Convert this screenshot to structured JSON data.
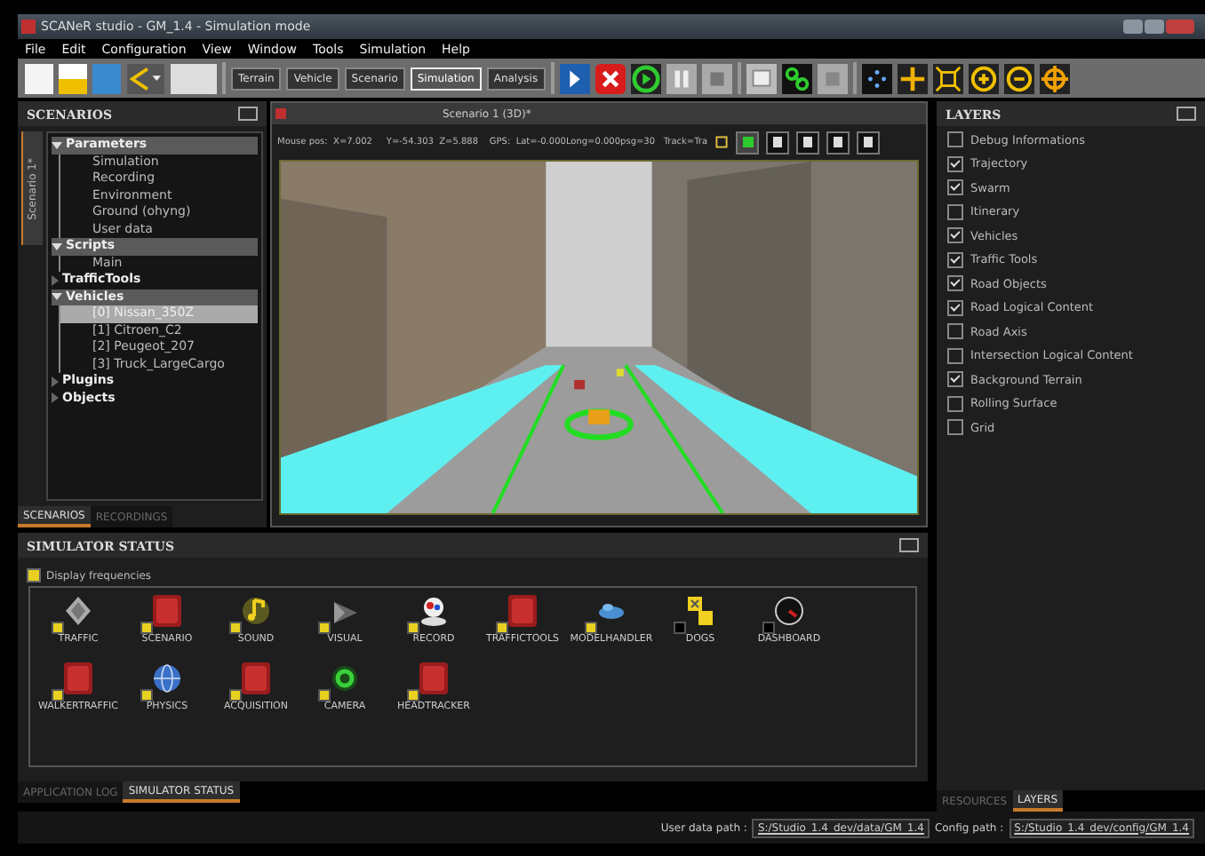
{
  "window": {
    "title": "SCANeR studio - GM_1.4 - Simulation mode"
  },
  "menu": [
    "File",
    "Edit",
    "Configuration",
    "View",
    "Window",
    "Tools",
    "Simulation",
    "Help"
  ],
  "modes": [
    {
      "label": "Terrain",
      "selected": false
    },
    {
      "label": "Vehicle",
      "selected": false
    },
    {
      "label": "Scenario",
      "selected": false
    },
    {
      "label": "Simulation",
      "selected": true
    },
    {
      "label": "Analysis",
      "selected": false
    }
  ],
  "scenarios": {
    "title": "SCENARIOS",
    "side_tab": "Scenario 1*",
    "tree": [
      {
        "label": "Parameters",
        "expanded": true,
        "selected": false,
        "children": [
          {
            "label": "Simulation",
            "selected": false
          },
          {
            "label": "Recording",
            "selected": false
          },
          {
            "label": "Environment",
            "selected": false
          },
          {
            "label": "Ground (ohyng)",
            "selected": false
          },
          {
            "label": "User data",
            "selected": false
          }
        ]
      },
      {
        "label": "Scripts",
        "expanded": true,
        "selected": false,
        "children": [
          {
            "label": "Main",
            "selected": false
          }
        ]
      },
      {
        "label": "TrafficTools",
        "expanded": false,
        "selected": false
      },
      {
        "label": "Vehicles",
        "expanded": true,
        "selected": false,
        "children": [
          {
            "label": "[0] Nissan_350Z",
            "selected": true
          },
          {
            "label": "[1] Citroen_C2",
            "selected": false
          },
          {
            "label": "[2] Peugeot_207",
            "selected": false
          },
          {
            "label": "[3] Truck_LargeCargo",
            "selected": false
          }
        ]
      },
      {
        "label": "Plugins",
        "expanded": false,
        "selected": false
      },
      {
        "label": "Objects",
        "expanded": false,
        "selected": false
      }
    ],
    "tabs": [
      {
        "label": "SCENARIOS",
        "selected": true
      },
      {
        "label": "RECORDINGS",
        "selected": false
      }
    ]
  },
  "view": {
    "title": "Scenario 1 (3D)*",
    "info": "Mouse pos:  X=7.002     Y=-54.303  Z=5.888    GPS:  Lat=-0.000Long=0.000psg=30   Track=Tra",
    "toggles": [
      {
        "on": true
      },
      {
        "on": false
      },
      {
        "on": false
      },
      {
        "on": false
      },
      {
        "on": false
      }
    ]
  },
  "layers": {
    "title": "LAYERS",
    "items": [
      {
        "label": "Debug Informations",
        "checked": false
      },
      {
        "label": "Trajectory",
        "checked": true
      },
      {
        "label": "Swarm",
        "checked": true
      },
      {
        "label": "Itinerary",
        "checked": false
      },
      {
        "label": "Vehicles",
        "checked": true
      },
      {
        "label": "Traffic Tools",
        "checked": true
      },
      {
        "label": "Road Objects",
        "checked": true
      },
      {
        "label": "Road Logical Content",
        "checked": true
      },
      {
        "label": "Road Axis",
        "checked": false
      },
      {
        "label": "Intersection Logical Content",
        "checked": false
      },
      {
        "label": "Background Terrain",
        "checked": true
      },
      {
        "label": "Rolling Surface",
        "checked": false
      },
      {
        "label": "Grid",
        "checked": false
      }
    ],
    "tabs": [
      {
        "label": "RESOURCES",
        "selected": false
      },
      {
        "label": "LAYERS",
        "selected": true
      }
    ]
  },
  "simulator_status": {
    "title": "SIMULATOR STATUS",
    "display_frequencies": {
      "label": "Display frequencies",
      "checked": true
    },
    "modules": [
      {
        "name": "TRAFFIC",
        "kind": "traffic",
        "checked": true
      },
      {
        "name": "SCENARIO",
        "kind": "red",
        "checked": true
      },
      {
        "name": "SOUND",
        "kind": "sound",
        "checked": true
      },
      {
        "name": "VISUAL",
        "kind": "visual",
        "checked": true
      },
      {
        "name": "RECORD",
        "kind": "record",
        "checked": true
      },
      {
        "name": "TRAFFICTOOLS",
        "kind": "red",
        "checked": true
      },
      {
        "name": "MODELHANDLER",
        "kind": "model",
        "checked": true
      },
      {
        "name": "DOGS",
        "kind": "dogs",
        "checked": false
      },
      {
        "name": "DASHBOARD",
        "kind": "dashboard",
        "checked": false
      },
      {
        "name": "WALKERTRAFFIC",
        "kind": "red",
        "checked": true
      },
      {
        "name": "PHYSICS",
        "kind": "physics",
        "checked": true
      },
      {
        "name": "ACQUISITION",
        "kind": "red",
        "checked": true
      },
      {
        "name": "CAMERA",
        "kind": "camera",
        "checked": true
      },
      {
        "name": "HEADTRACKER",
        "kind": "red",
        "checked": true
      }
    ]
  },
  "bottom_tabs": [
    {
      "label": "APPLICATION LOG",
      "selected": false
    },
    {
      "label": "SIMULATOR STATUS",
      "selected": true
    }
  ],
  "status_bar": {
    "user_label": "User data path :",
    "user_path": "S:/Studio_1.4_dev/data/GM_1.4",
    "config_label": "Config path :",
    "config_path": "S:/Studio_1.4_dev/config/GM_1.4"
  }
}
